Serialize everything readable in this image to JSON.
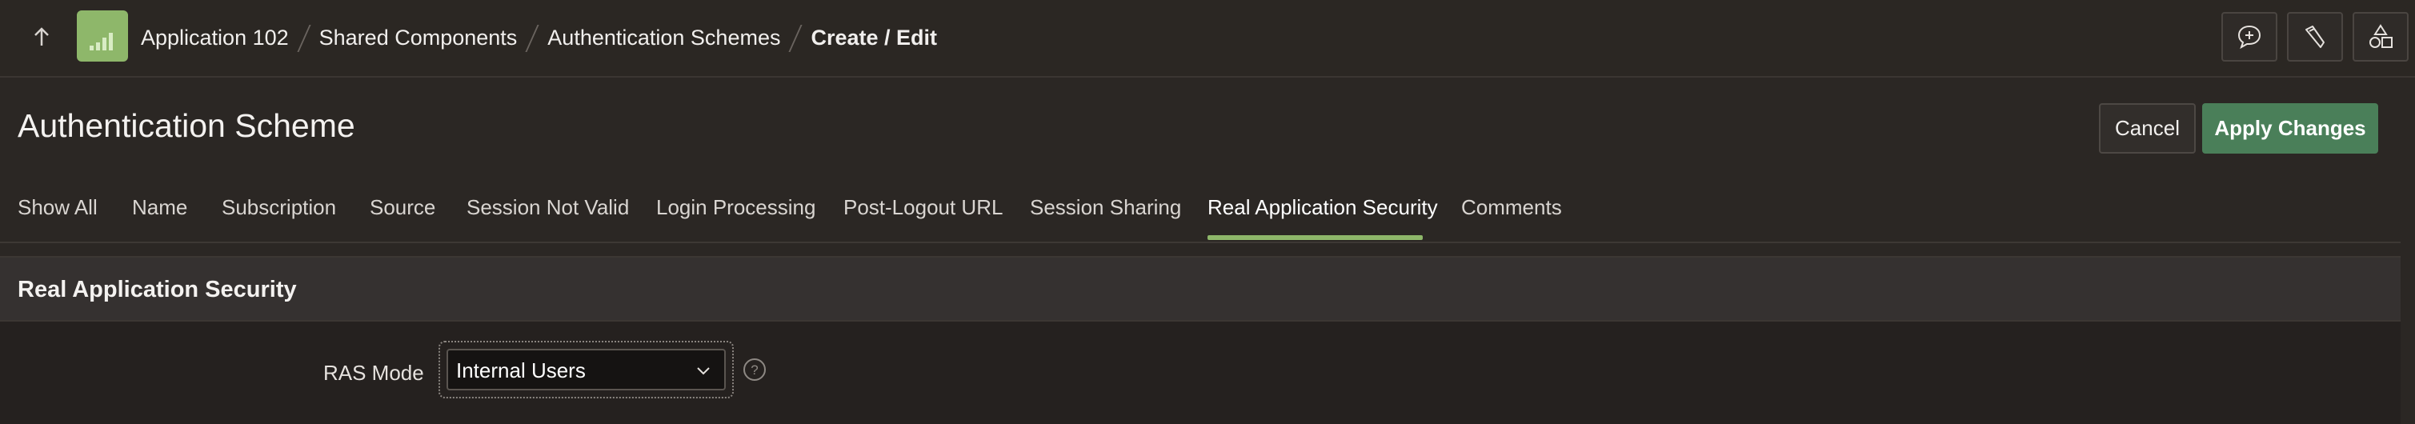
{
  "topbar": {
    "breadcrumb": {
      "app": "Application 102",
      "shared": "Shared Components",
      "schemes": "Authentication Schemes",
      "current": "Create / Edit"
    },
    "icons": {
      "up": "arrow-up-icon",
      "app": "app-chart-icon",
      "comment": "comment-add-icon",
      "utilities": "wrench-icon",
      "shared": "shapes-icon"
    }
  },
  "header": {
    "title": "Authentication Scheme",
    "cancel_label": "Cancel",
    "apply_label": "Apply Changes"
  },
  "tabs": {
    "show_all": "Show All",
    "name": "Name",
    "subscription": "Subscription",
    "source": "Source",
    "session_not_valid": "Session Not Valid",
    "login_processing": "Login Processing",
    "post_logout_url": "Post-Logout URL",
    "session_sharing": "Session Sharing",
    "ras": "Real Application Security",
    "comments": "Comments",
    "active": "Real Application Security"
  },
  "region": {
    "title": "Real Application Security",
    "ras_mode": {
      "label": "RAS Mode",
      "value": "Internal Users"
    }
  },
  "colors": {
    "accent_green": "#8eb76a",
    "apply_button": "#4a7f59",
    "background": "#2b2724"
  }
}
